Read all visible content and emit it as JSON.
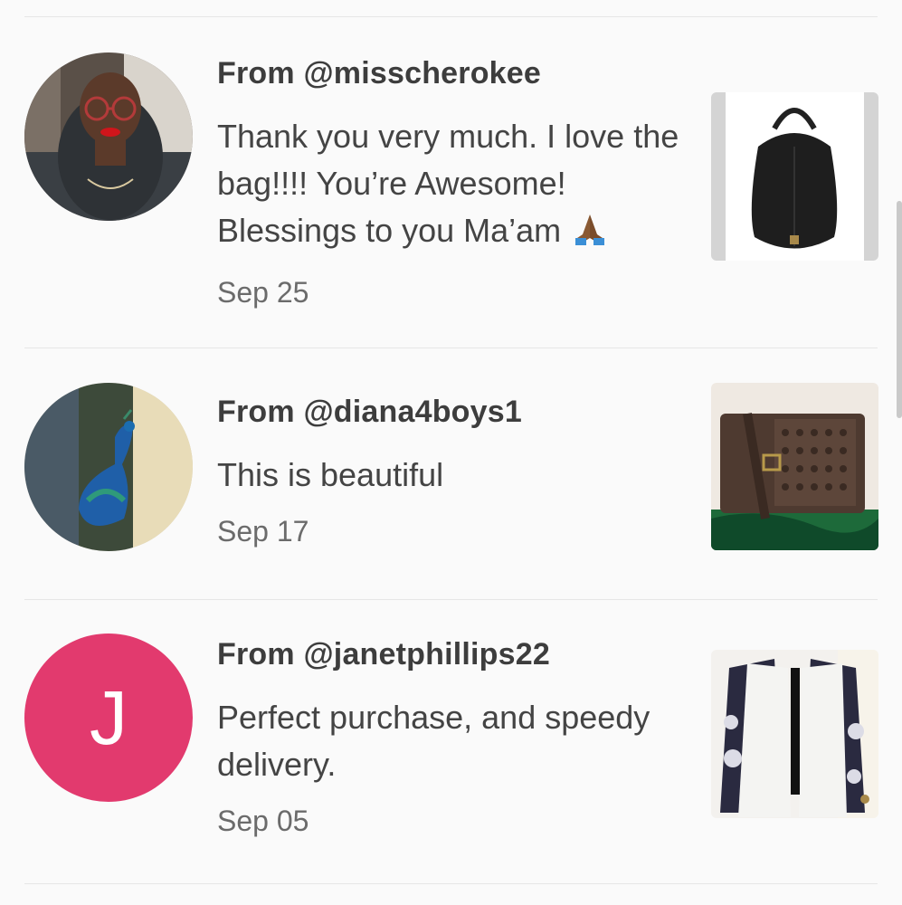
{
  "reviews": [
    {
      "from": "From @misscherokee",
      "message": "Thank you very much. I love the bag!!!! You’re Awesome! Blessings to you Ma’am",
      "emoji": "folded-hands-emoji",
      "date": "Sep 25",
      "avatar": "profile-photo",
      "thumbnail": "black-leather-hobo-bag"
    },
    {
      "from": "From @diana4boys1",
      "message": "This is beautiful",
      "date": "Sep 17",
      "avatar": "peacock-photo",
      "thumbnail": "brown-logo-crossbody-bag"
    },
    {
      "from": "From @janetphillips22",
      "message": "Perfect purchase, and speedy delivery.",
      "date": "Sep 05",
      "avatar_letter": "J",
      "avatar_color": "#e23a6e",
      "thumbnail": "white-patterned-kimono"
    }
  ]
}
